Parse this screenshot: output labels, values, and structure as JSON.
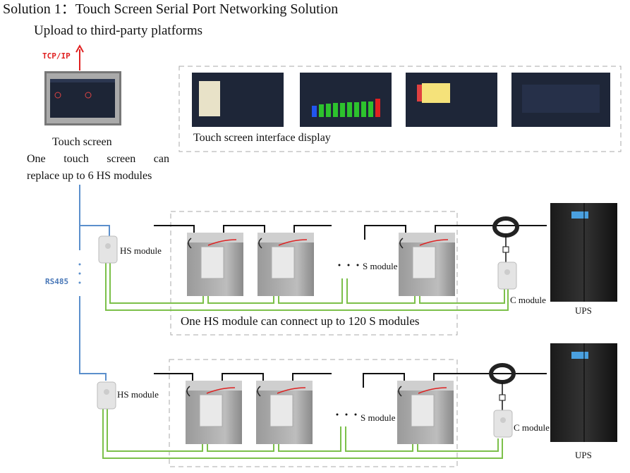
{
  "title": "Solution 1：Touch Screen Serial Port Networking Solution",
  "upload": "Upload to third-party platforms",
  "protocol_up": "TCP/IP",
  "touch_screen": {
    "label": "Touch screen",
    "desc_line1": "One touch screen can",
    "desc_line2": "replace up to 6 HS modules"
  },
  "interface_display": "Touch screen interface display",
  "bus": "RS485",
  "rows": [
    {
      "hs": "HS module",
      "s": "S module",
      "c": "C module",
      "ups": "UPS",
      "caption": "One HS module can connect up to 120 S modules"
    },
    {
      "hs": "HS module",
      "s": "S module",
      "c": "C module",
      "ups": "UPS"
    }
  ],
  "colors": {
    "tcp": "#e02020",
    "rs485": "#5b8fcc",
    "comm_wire": "#7cc04a",
    "power_wire": "#111111",
    "dashed_box": "#aaaaaa"
  }
}
